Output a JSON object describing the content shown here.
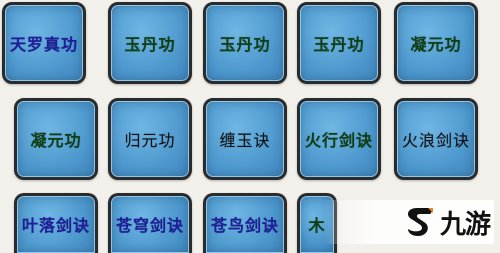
{
  "skills": [
    {
      "label": "天罗真功",
      "color": "#1e1e9a"
    },
    {
      "label": "玉丹功",
      "color": "#0f3f12"
    },
    {
      "label": "玉丹功",
      "color": "#0f3f12"
    },
    {
      "label": "玉丹功",
      "color": "#0f3f12"
    },
    {
      "label": "凝元功",
      "color": "#0f3f12"
    },
    {
      "label": "凝元功",
      "color": "#0f3f12"
    },
    {
      "label": "归元功",
      "color": "#101010"
    },
    {
      "label": "缠玉诀",
      "color": "#101010"
    },
    {
      "label": "火行剑诀",
      "color": "#0f3f12"
    },
    {
      "label": "火浪剑诀",
      "color": "#101010"
    },
    {
      "label": "叶落剑诀",
      "color": "#1e1e9a"
    },
    {
      "label": "苍穹剑诀",
      "color": "#1e1e9a"
    },
    {
      "label": "苍鸟剑诀",
      "color": "#1e1e9a"
    },
    {
      "label": "木",
      "color": "#0f3f12"
    }
  ],
  "watermark": {
    "text": "九游",
    "accent": "#f0861a"
  }
}
